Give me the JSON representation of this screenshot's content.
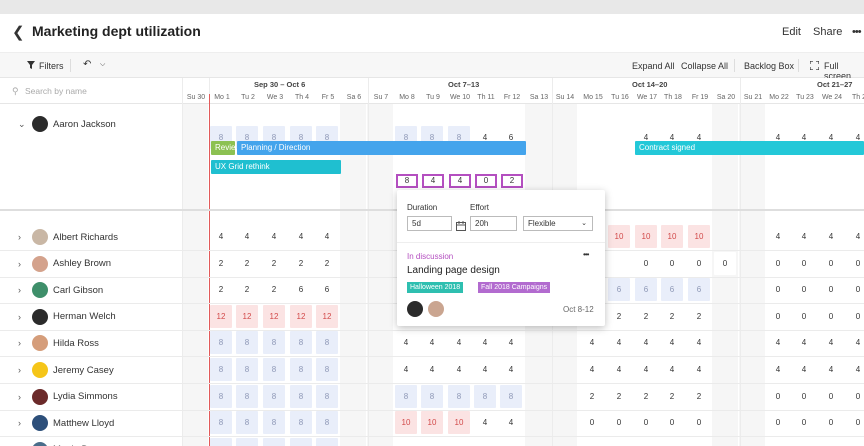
{
  "header": {
    "title": "Marketing dept utilization",
    "edit": "Edit",
    "share": "Share",
    "more": "•••"
  },
  "toolbar": {
    "filters": "Filters",
    "expand_all": "Expand All",
    "collapse_all": "Collapse All",
    "backlog_box": "Backlog Box",
    "full_screen": "Full screen"
  },
  "search": {
    "placeholder": "Search by name"
  },
  "weeks": [
    "Sep 30 – Oct 6",
    "Oct 7–13",
    "Oct 14–20",
    "Oct 21–27"
  ],
  "days": [
    "Su 30",
    "Mo 1",
    "Tu 2",
    "We 3",
    "Th 4",
    "Fr 5",
    "Sa 6",
    "Su 7",
    "Mo 8",
    "Tu 9",
    "We 10",
    "Th 11",
    "Fr 12",
    "Sa 13",
    "Su 14",
    "Mo 15",
    "Tu 16",
    "We 17",
    "Th 18",
    "Fr 19",
    "Sa 20",
    "Su 21",
    "Mo 22",
    "Tu 23",
    "We 24",
    "Th 2"
  ],
  "aaron": {
    "name": "Aaron Jackson",
    "week1": [
      "8",
      "8",
      "8",
      "8",
      "8"
    ],
    "week2": [
      "8",
      "8",
      "8",
      "4",
      "6"
    ],
    "week3": [
      "4",
      "4",
      "4"
    ],
    "week4": [
      "4",
      "4",
      "4",
      "4"
    ],
    "bars": {
      "review": "Revie",
      "planning": "Planning / Direction",
      "ux": "UX Grid rethink",
      "contract": "Contract signed"
    },
    "selected": [
      "8",
      "4",
      "4",
      "0",
      "2"
    ]
  },
  "people": [
    {
      "name": "Albert Richards"
    },
    {
      "name": "Ashley Brown"
    },
    {
      "name": "Carl Gibson"
    },
    {
      "name": "Herman Welch"
    },
    {
      "name": "Hilda Ross"
    },
    {
      "name": "Jeremy Casey"
    },
    {
      "name": "Lydia Simmons"
    },
    {
      "name": "Matthew Lloyd"
    },
    {
      "name": "Mattie Dean"
    }
  ],
  "popup": {
    "duration_label": "Duration",
    "effort_label": "Effort",
    "duration_value": "5d",
    "effort_value": "20h",
    "mode_value": "Flexible",
    "status": "In discussion",
    "task": "Landing page design",
    "tags": [
      "Halloween 2018",
      "Fall 2018 Campaigns"
    ],
    "dates": "Oct 8-12",
    "more": "•••"
  },
  "colors": {
    "planning": "#44a4ec",
    "review": "#8cc152",
    "ux": "#1fbfd0",
    "contract": "#23c8d8",
    "status": "#b44fc0",
    "tag1": "#2ebfb0",
    "tag2": "#b26bcf",
    "today": "#e25b5b"
  }
}
